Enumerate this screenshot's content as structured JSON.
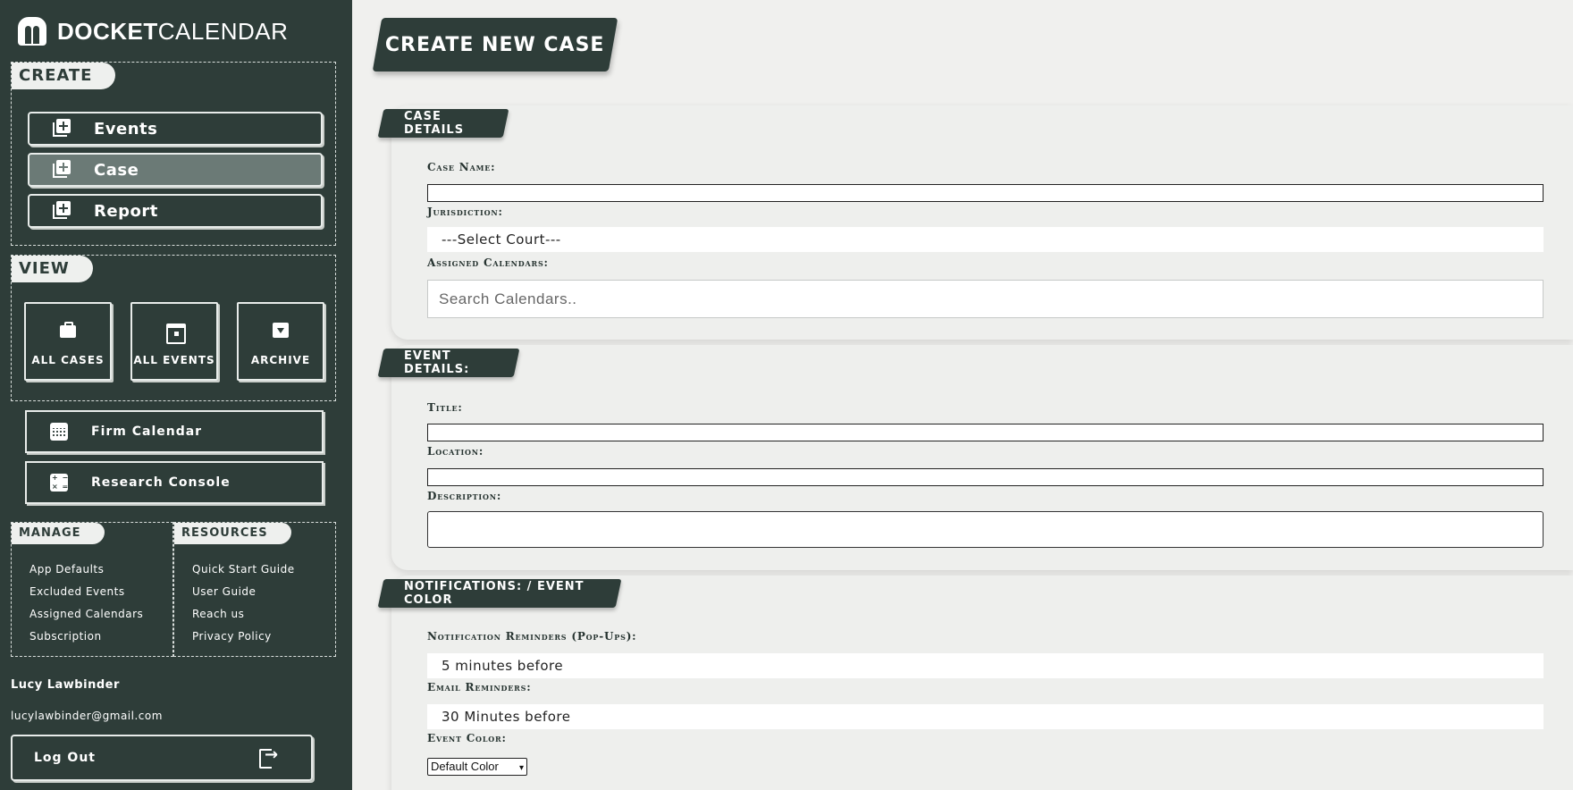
{
  "brand": {
    "bold": "DOCKET",
    "light": "CALENDAR"
  },
  "sidebar": {
    "create": {
      "label": "CREATE",
      "items": [
        {
          "label": "Events",
          "active": false
        },
        {
          "label": "Case",
          "active": true
        },
        {
          "label": "Report",
          "active": false
        }
      ]
    },
    "view": {
      "label": "VIEW",
      "tiles": [
        {
          "label": "ALL CASES",
          "icon": "briefcase-icon"
        },
        {
          "label": "ALL EVENTS",
          "icon": "calendar-icon"
        },
        {
          "label": "ARCHIVE",
          "icon": "archive-icon"
        }
      ]
    },
    "firm_calendar": "Firm Calendar",
    "research_console": "Research Console",
    "manage": {
      "label": "MANAGE",
      "links": [
        "App Defaults",
        "Excluded Events",
        "Assigned Calendars",
        "Subscription"
      ]
    },
    "resources": {
      "label": "RESOURCES",
      "links": [
        "Quick Start Guide",
        "User Guide",
        "Reach us",
        "Privacy Policy"
      ]
    },
    "user": {
      "name": "Lucy Lawbinder",
      "email": "lucylawbinder@gmail.com"
    },
    "logout": "Log Out"
  },
  "main": {
    "title": "CREATE NEW CASE",
    "case_details": {
      "tab": "CASE DETAILS",
      "case_name_label": "Case Name:",
      "case_name_value": "",
      "jurisdiction_label": "Jurisdiction:",
      "jurisdiction_value": "---Select Court---",
      "calendars_label": "Assigned Calendars:",
      "calendars_placeholder": "Search Calendars.."
    },
    "event_details": {
      "tab": "EVENT DETAILS:",
      "title_label": "Title:",
      "location_label": "Location:",
      "description_label": "Description:"
    },
    "notifications": {
      "tab": "NOTIFICATIONS: / EVENT COLOR",
      "popup_label": "Notification Reminders (Pop-Ups):",
      "popup_value": "5 minutes before",
      "email_label": "Email Reminders:",
      "email_value": "30 Minutes before",
      "color_label": "Event Color:",
      "color_value": "Default Color"
    }
  },
  "colors": {
    "sidebar": "#2e3d39",
    "active_button": "#6b7a76",
    "background": "#f0f0ee"
  }
}
